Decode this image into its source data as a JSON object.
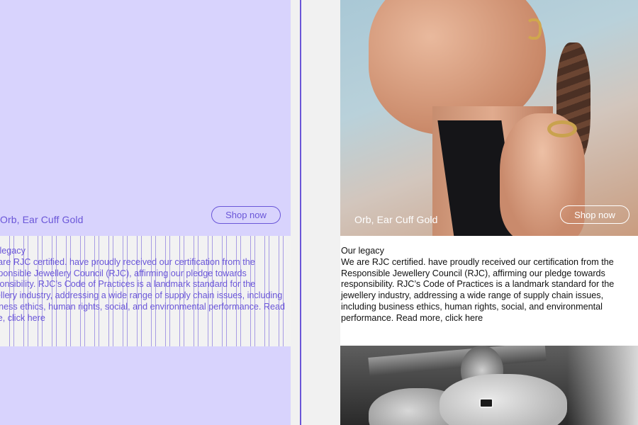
{
  "product": {
    "name": "Orb, Ear Cuff Gold",
    "cta_label": "Shop now"
  },
  "legacy": {
    "heading": "Our legacy",
    "body": "We are RJC certified. have proudly received our certification from the Responsible Jewellery Council (RJC), affirming our pledge towards responsibility. RJC’s Code of Practices is a landmark standard for the jewellery industry, addressing a wide range of supply chain issues, including business ethics, human rights, social, and environmental performance.",
    "link_text": "Read more, click here"
  },
  "colors": {
    "overlay_bg": "#d8d3fd",
    "overlay_accent": "#6a56d8",
    "page_bg": "#f1f1f1"
  },
  "images": {
    "hero": "model-wearing-ear-cuff-and-ring-photo",
    "craft": "jeweller-hands-at-work-bw-photo"
  }
}
